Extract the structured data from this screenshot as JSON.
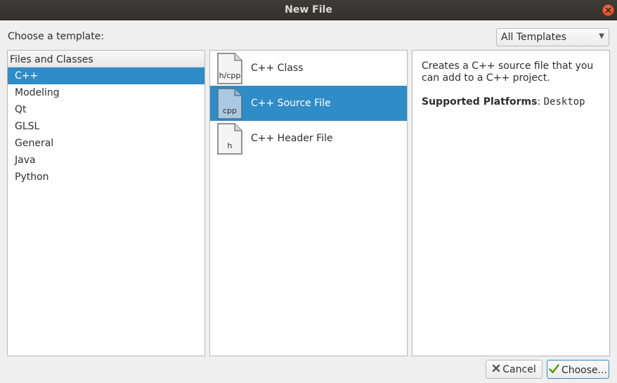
{
  "window": {
    "title": "New File"
  },
  "header": {
    "choose_label": "Choose a template:",
    "filter_value": "All Templates"
  },
  "categories": {
    "header": "Files and Classes",
    "items": [
      {
        "label": "C++",
        "selected": true
      },
      {
        "label": "Modeling"
      },
      {
        "label": "Qt"
      },
      {
        "label": "GLSL"
      },
      {
        "label": "General"
      },
      {
        "label": "Java"
      },
      {
        "label": "Python"
      }
    ]
  },
  "templates": [
    {
      "label": "C++ Class",
      "icon": "h-cpp-file-icon",
      "icon_text": "h/cpp"
    },
    {
      "label": "C++ Source File",
      "icon": "cpp-file-icon",
      "icon_text": "cpp",
      "selected": true
    },
    {
      "label": "C++ Header File",
      "icon": "h-file-icon",
      "icon_text": "h"
    }
  ],
  "description": {
    "text": "Creates a C++ source file that you can add to a C++ project.",
    "platforms_label": "Supported Platforms",
    "platforms_value": "Desktop"
  },
  "buttons": {
    "cancel_label": "Cancel",
    "choose_label": "Choose..."
  },
  "colors": {
    "selection": "#308cc6",
    "titlebar": "#3c3b37",
    "close": "#e95420"
  }
}
